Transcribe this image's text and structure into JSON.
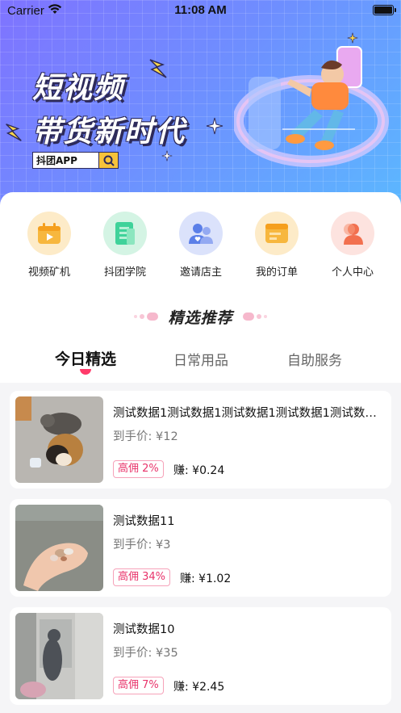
{
  "status_bar": {
    "carrier": "Carrier",
    "time": "11:08 AM"
  },
  "banner": {
    "slogan_line1": "短视频",
    "slogan_line2": "带货新时代",
    "app_tag": "抖团APP"
  },
  "quick_menu": [
    {
      "label": "视频矿机",
      "icon": "video-miner-icon",
      "bg": "#fdebc8"
    },
    {
      "label": "抖团学院",
      "icon": "academy-icon",
      "bg": "#d4f4e4"
    },
    {
      "label": "邀请店主",
      "icon": "invite-owner-icon",
      "bg": "#dbe2fb"
    },
    {
      "label": "我的订单",
      "icon": "orders-icon",
      "bg": "#fdebc8"
    },
    {
      "label": "个人中心",
      "icon": "profile-icon",
      "bg": "#fde3df"
    }
  ],
  "section_title": "精选推荐",
  "tabs": [
    "今日精选",
    "日常用品",
    "自助服务"
  ],
  "active_tab": 0,
  "products": [
    {
      "name": "测试数据1测试数据1测试数据1测试数据1测试数据1",
      "price_label": "到手价:",
      "price": "¥12",
      "commission": "高佣 2%",
      "earn_label": "赚:",
      "earn": "¥0.24"
    },
    {
      "name": "测试数据11",
      "price_label": "到手价:",
      "price": "¥3",
      "commission": "高佣 34%",
      "earn_label": "赚:",
      "earn": "¥1.02"
    },
    {
      "name": "测试数据10",
      "price_label": "到手价:",
      "price": "¥35",
      "commission": "高佣 7%",
      "earn_label": "赚:",
      "earn": "¥2.45"
    }
  ],
  "colors": {
    "accent": "#ff3b6a",
    "commission_text": "#e8336a",
    "banner_start": "#7f73ff",
    "banner_end": "#5bb8ff"
  }
}
